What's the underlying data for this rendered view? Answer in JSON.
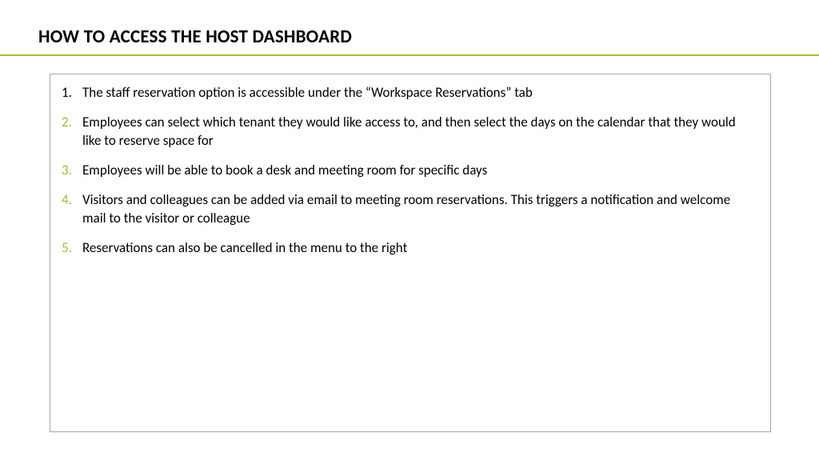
{
  "title": "HOW TO ACCESS THE HOST DASHBOARD",
  "items": [
    "The staff reservation option is accessible under the “Workspace Reservations” tab",
    "Employees can select which tenant they would like access to, and then select the days on the calendar that they would like to reserve space for",
    "Employees will be able to book a desk and meeting room for specific days",
    "Visitors and colleagues can be added via email to meeting room reservations. This triggers a notification and welcome mail to the visitor or colleague",
    "Reservations can also be cancelled in the menu to the right"
  ],
  "colors": {
    "accent": "#a0bf2f",
    "border": "#a6a6a6",
    "text": "#000000",
    "background": "#ffffff"
  }
}
